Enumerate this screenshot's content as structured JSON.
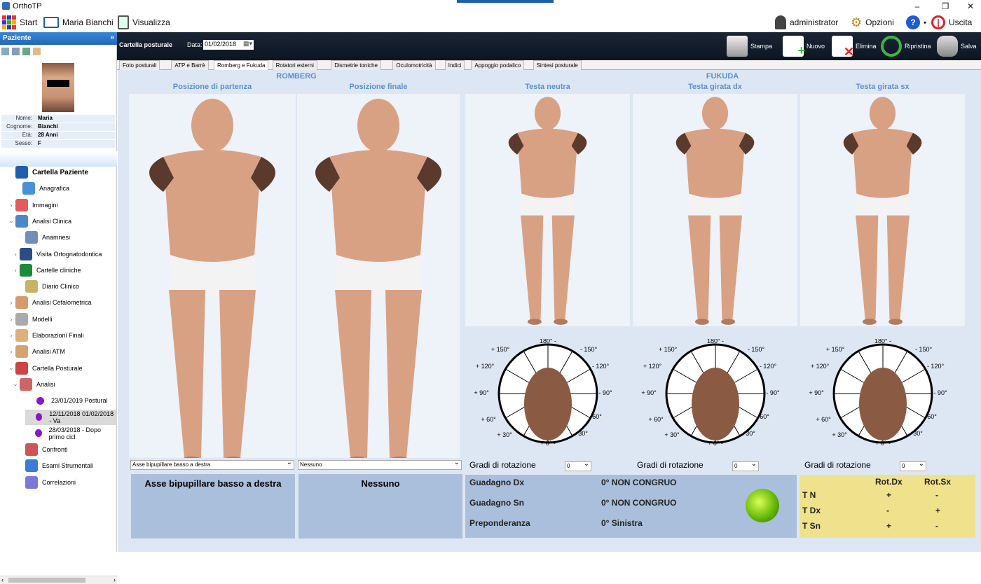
{
  "app": {
    "title": "OrthoTP"
  },
  "topbar": {
    "start": "Start",
    "patient_name": "Maria Bianchi",
    "view": "Visualizza",
    "user": "administrator",
    "options": "Opzioni",
    "help": "?",
    "exit": "Uscita"
  },
  "left": {
    "header": "Paziente",
    "fields": [
      {
        "k": "Nome:",
        "v": "Maria"
      },
      {
        "k": "Cognome:",
        "v": "Bianchi"
      },
      {
        "k": "Età:",
        "v": "28 Anni"
      },
      {
        "k": "Sesso:",
        "v": "F"
      }
    ],
    "tree": [
      {
        "label": "Cartella Paziente",
        "arrow": "",
        "indent": 10,
        "color": "#1f5fad"
      },
      {
        "label": "Anagrafica",
        "arrow": "",
        "indent": 20,
        "color": "#4a90d9"
      },
      {
        "label": "Immagini",
        "arrow": ">",
        "indent": 10,
        "color": "#e35b5b"
      },
      {
        "label": "Analisi Clinica",
        "arrow": "v",
        "indent": 10,
        "color": "#4f86c6"
      },
      {
        "label": "Anamnesi",
        "arrow": "",
        "indent": 24,
        "color": "#6d8fb8"
      },
      {
        "label": "Visita Ortognatodontica",
        "arrow": ">",
        "indent": 16,
        "color": "#2c4c84"
      },
      {
        "label": "Cartelle cliniche",
        "arrow": ">",
        "indent": 16,
        "color": "#1b8a3a"
      },
      {
        "label": "Diario Clinico",
        "arrow": "",
        "indent": 24,
        "color": "#c7b266"
      },
      {
        "label": "Analisi Cefalometrica",
        "arrow": ">",
        "indent": 10,
        "color": "#d79a6a"
      },
      {
        "label": "Modelli",
        "arrow": ">",
        "indent": 10,
        "color": "#aaaaaa"
      },
      {
        "label": "Elaborazioni Finali",
        "arrow": ">",
        "indent": 10,
        "color": "#e0b07a"
      },
      {
        "label": "Analisi ATM",
        "arrow": ">",
        "indent": 10,
        "color": "#d4a373"
      },
      {
        "label": "Cartella Posturale",
        "arrow": "v",
        "indent": 10,
        "color": "#c44"
      },
      {
        "label": "Analisi",
        "arrow": "v",
        "indent": 16,
        "color": "#c66"
      },
      {
        "label": "23/01/2019 Postural",
        "arrow": "",
        "indent": 40,
        "color": "dot"
      },
      {
        "label": "12/11/2018 01/02/2018 - Va",
        "arrow": "",
        "indent": 40,
        "color": "dot",
        "selected": true
      },
      {
        "label": "28/03/2018 - Dopo primo cicl",
        "arrow": "",
        "indent": 40,
        "color": "dot"
      },
      {
        "label": "Confronti",
        "arrow": "",
        "indent": 24,
        "color": "#c55"
      },
      {
        "label": "Esami Strumentali",
        "arrow": "",
        "indent": 24,
        "color": "#3b7bd6"
      },
      {
        "label": "Correlazioni",
        "arrow": "",
        "indent": 24,
        "color": "#7a7ad6"
      }
    ]
  },
  "toolbar": {
    "section": "Cartella posturale",
    "date_label": "Data:",
    "date": "01/02/2018",
    "print": "Stampa",
    "new": "Nuovo",
    "delete": "Elimina",
    "restore": "Ripristina",
    "save": "Salva"
  },
  "tabs": [
    "Foto posturali",
    "ATP e Barrè",
    "Romberg e Fukuda",
    "Rotatori esterni",
    "Dismetrie toniche",
    "Oculomotricità",
    "Indici",
    "Appoggio podalico",
    "Sintesi posturale"
  ],
  "romberg": {
    "title": "ROMBERG",
    "start": "Posizione di partenza",
    "end": "Posizione finale",
    "dd1": "Asse bipupillare basso a destra",
    "dd2": "Nessuno",
    "res1": "Asse bipupillare basso a destra",
    "res2": "Nessuno"
  },
  "fukuda": {
    "title": "FUKUDA",
    "h1": "Testa neutra",
    "h2": "Testa girata dx",
    "h3": "Testa girata sx",
    "rot_label": "Gradi di rotazione",
    "rot_val": "0",
    "dial": {
      "n": "180° -",
      "ne": "- 150°",
      "e1": "- 120°",
      "e2": "- 90°",
      "e3": "60°",
      "e4": "30°",
      "s": "+ 0° -",
      "w1": "+ 150°",
      "w2": "+ 120°",
      "w3": "+ 90°",
      "w4": "+ 60°",
      "w5": "+ 30°"
    },
    "results": [
      {
        "k": "Guadagno Dx",
        "v": "0° NON CONGRUO"
      },
      {
        "k": "Guadagno Sn",
        "v": "0° NON CONGRUO"
      },
      {
        "k": "Preponderanza",
        "v": "0° Sinistra"
      }
    ],
    "table": {
      "h1": "Rot.Dx",
      "h2": "Rot.Sx",
      "rows": [
        {
          "k": "T N",
          "a": "+",
          "b": "-"
        },
        {
          "k": "T Dx",
          "a": "-",
          "b": "+"
        },
        {
          "k": "T Sn",
          "a": "+",
          "b": "-"
        }
      ]
    }
  },
  "colors": {
    "accent": "#5b8fd6",
    "panel": "#a9bfdb",
    "yellow": "#f0e28c"
  }
}
